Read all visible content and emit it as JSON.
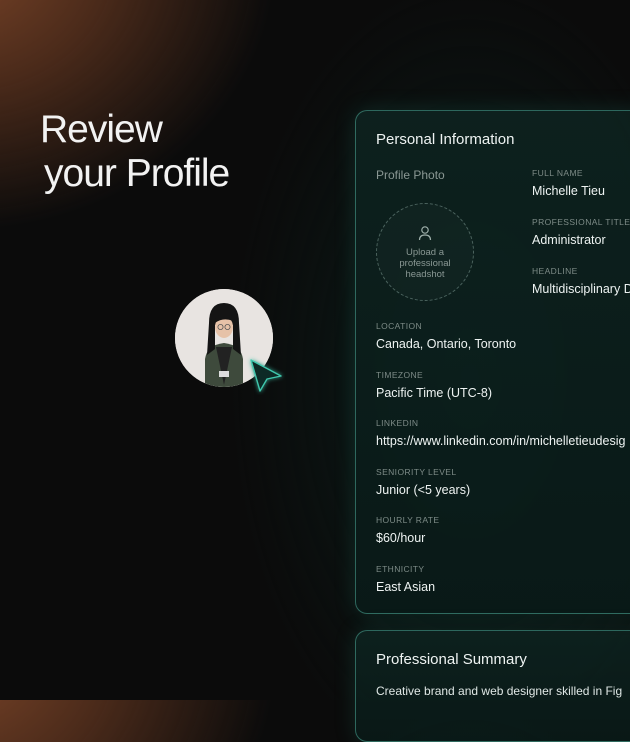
{
  "hero": {
    "line1": "Review",
    "line2": "your Profile"
  },
  "personal": {
    "title": "Personal Information",
    "photo_label": "Profile Photo",
    "upload_text": "Upload a professional headshot",
    "full_name": {
      "label": "FULL NAME",
      "value": "Michelle Tieu"
    },
    "professional_title": {
      "label": "PROFESSIONAL TITLE",
      "value": "Administrator"
    },
    "headline": {
      "label": "HEADLINE",
      "value": "Multidisciplinary D"
    },
    "location": {
      "label": "LOCATION",
      "value": "Canada, Ontario, Toronto"
    },
    "timezone": {
      "label": "TIMEZONE",
      "value": "Pacific Time (UTC-8)"
    },
    "linkedin": {
      "label": "LINKEDIN",
      "value": "https://www.linkedin.com/in/michelletieudesig"
    },
    "seniority": {
      "label": "SENIORITY LEVEL",
      "value": "Junior (<5 years)"
    },
    "hourly_rate": {
      "label": "HOURLY RATE",
      "value": "$60/hour"
    },
    "ethnicity": {
      "label": "ETHNICITY",
      "value": "East Asian"
    }
  },
  "summary": {
    "title": "Professional Summary",
    "text": "Creative brand and web designer skilled in Fig"
  },
  "colors": {
    "accent": "#3fc7ad",
    "card_bg": "#0e221f",
    "warm_glow": "#7a4428"
  },
  "icons": {
    "upload": "user-icon",
    "pointer": "cursor-arrow-icon"
  }
}
